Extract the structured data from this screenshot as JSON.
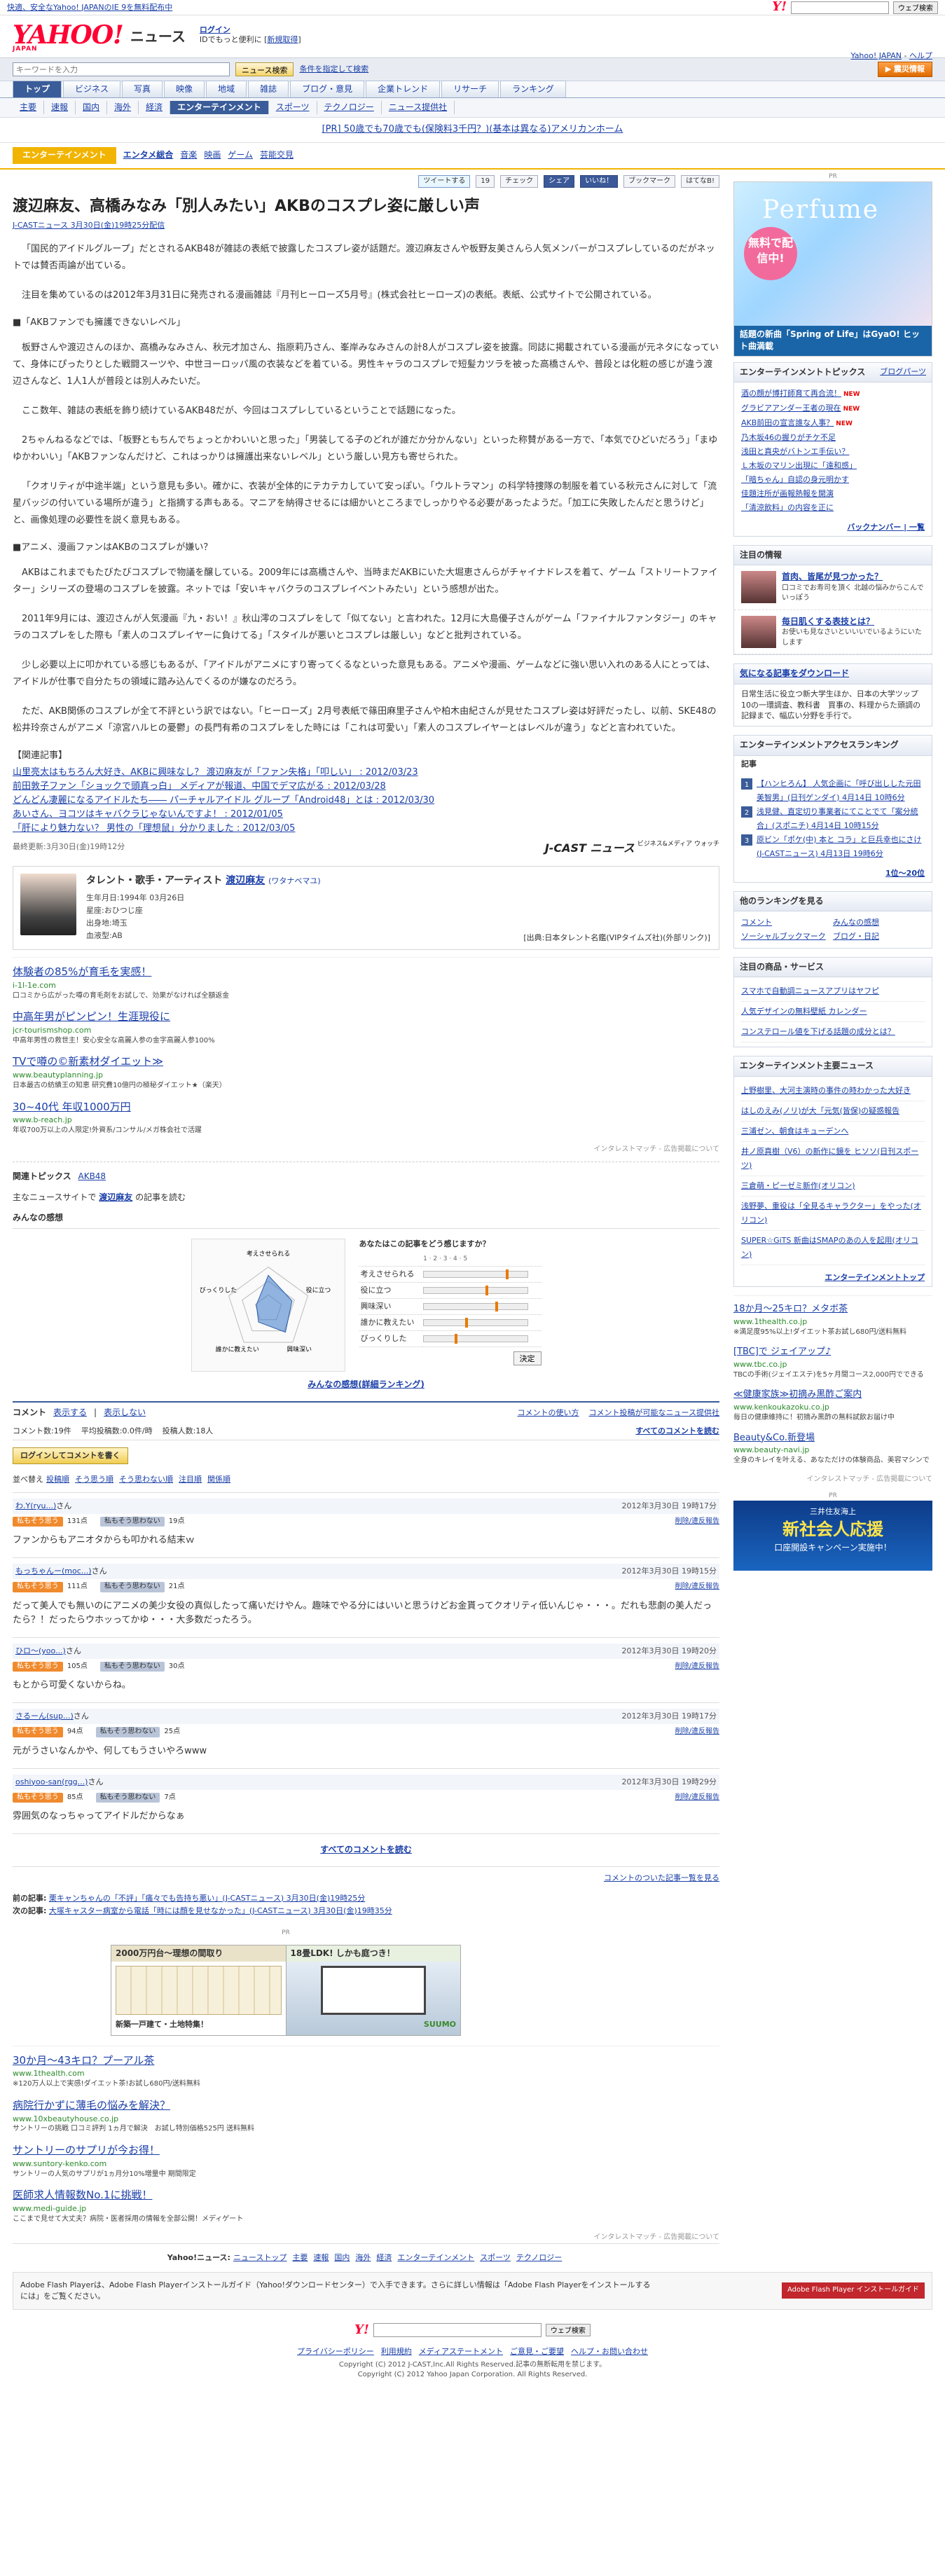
{
  "topbar": {
    "promo": "快適、安全なYahoo! JAPANのIE 9を無料配布中",
    "search_button": "ウェブ検索"
  },
  "header": {
    "logo": "YAHOO!",
    "logo_sub": "JAPAN",
    "title": "ニュース",
    "login_link": "ログイン",
    "login_sub": "IDでもっと便利に",
    "register_link": "新規取得",
    "top_link": "Yahoo! JAPAN",
    "help_link": "ヘルプ"
  },
  "search": {
    "placeholder": "キーワードを入力",
    "button": "ニュース検索",
    "advanced": "条件を指定して検索",
    "special": "▶ 震災情報"
  },
  "nav1": [
    "トップ",
    "ビジネス",
    "写真",
    "映像",
    "地域",
    "雑誌",
    "ブログ・意見",
    "企業トレンド",
    "リサーチ",
    "ランキング"
  ],
  "nav2": [
    "主要",
    "速報",
    "国内",
    "海外",
    "経済",
    "エンターテインメント",
    "スポーツ",
    "テクノロジー",
    "ニュース提供社"
  ],
  "nav2_active": 5,
  "pr_line": "[PR] 50歳でも70歳でも(保険料3千円？)(基本は異なる)アメリカンホーム",
  "category": {
    "tag": "エンターテインメント",
    "links": [
      "エンタメ総合",
      "音楽",
      "映画",
      "ゲーム",
      "芸能交見"
    ]
  },
  "social": [
    "ツイートする",
    "19",
    "チェック",
    "シェア",
    "いいね！",
    "ブックマーク",
    "はてなB!"
  ],
  "article": {
    "title": "渡辺麻友、高橋みなみ「別人みたい」AKBのコスプレ姿に厳しい声",
    "meta": "J-CASTニュース 3月30日(金)19時25分配信",
    "p1": "「国民的アイドルグループ」だとされるAKB48が雑誌の表紙で披露したコスプレ姿が話題だ。渡辺麻友さんや板野友美さんら人気メンバーがコスプレしているのだがネットでは賛否両論が出ている。",
    "p2": "注目を集めているのは2012年3月31日に発売される漫画雑誌『月刊ヒーローズ5月号』(株式会社ヒーローズ)の表紙。表紙、公式サイトで公開されている。",
    "h1": "■「AKBファンでも擁護できないレベル」",
    "p3": "板野さんや渡辺さんのほか、高橋みなみさん、秋元才加さん、指原莉乃さん、峯岸みなみさんの計8人がコスプレ姿を披露。同誌に掲載されている漫画が元ネタになっていて、身体にぴったりとした戦闘スーツや、中世ヨーロッパ風の衣装などを着ている。男性キャラのコスプレで短髪カツラを被った高橋さんや、普段とは化粧の感じが違う渡辺さんなど、1人1人が普段とは別人みたいだ。",
    "p4": "ここ数年、雑誌の表紙を飾り続けているAKB48だが、今回はコスプレしているということで話題になった。",
    "p5": "2ちゃんねるなどでは、「板野ともちんでちょっとかわいいと思った」「男装してる子のどれが誰だか分かんない」といった称賛がある一方で、「本気でひどいだろう」「まゆゆかわいい」「AKBファンなんだけど、これはっかりは擁護出来ないレベル」という厳しい見方も寄せられた。",
    "p6": "「クオリティが中途半端」という意見も多い。確かに、衣装が全体的にテカテカしていて安っぽい。「ウルトラマン」の科学特捜隊の制服を着ている秋元さんに対して「流星バッジの付いている場所が違う」と指摘する声もある。マニアを納得させるには細かいところまでしっかりやる必要があったようだ。「加工に失敗したんだと思うけど」と、画像処理の必要性を説く意見もある。",
    "h2": "■アニメ、漫画ファンはAKBのコスプレが嫌い？",
    "p7": "AKBはこれまでもたびたびコスプレで物議を醸している。2009年には高橋さんや、当時まだAKBにいた大堀恵さんらがチャイナドレスを着て、ゲーム「ストリートファイター」シリーズの登場のコスプレを披露。ネットでは「安いキャバクラのコスプレイベントみたい」という感想が出た。",
    "p8": "2011年9月には、渡辺さんが人気漫画『九・おい！』秋山澪のコスプレをして「似てない」と言われた。12月に大島優子さんがゲーム「ファイナルファンタジー」のキャラのコスプレをした際も「素人のコスプレイヤーに負けてる」「スタイルが悪いとコスプレは厳しい」などと批判されている。",
    "p9": "少し必要以上に叩かれている感じもあるが、「アイドルがアニメにすり寄ってくるなといった意見もある。アニメや漫画、ゲームなどに強い思い入れのある人にとっては、アイドルが仕事で自分たちの領域に踏み込んでくるのが嫌なのだろう。",
    "p10": "ただ、AKB関係のコスプレが全て不評という訳ではない。「ヒーローズ」2月号表紙で篠田麻里子さんや柏木由紀さんが見せたコスプレ姿は好評だったし、以前、SKE48の松井玲奈さんがアニメ「涼宮ハルヒの憂鬱」の長門有希のコスプレをした時には「これは可愛い」「素人のコスプレイヤーとはレベルが違う」などと言われていた。",
    "related_h": "【関連記事】",
    "related": [
      "山里亮太はもちろん大好き、AKBに興味なし？ 渡辺麻友が「ファン失格」「叩しい」 : 2012/03/23",
      "前田敦子ファン「ショックで頭真っ白」 メディアが報道、中国でデマ広がる : 2012/03/28",
      "どんどん凄麗になるアイドルたち―― パーチャルアイドル グループ「Android48」とは : 2012/03/30",
      "あいさん、ヨコツはキャバクラじゃないんですよ！ : 2012/01/05",
      "「肝により魅力ない？ 男性の「理想鼠」分かりました : 2012/03/05"
    ],
    "updated": "最終更新:3月30日(金)19時12分",
    "jcast": "J-CAST ニュース",
    "jcast_sub": "ビジネス&メディア ウォッチ"
  },
  "talent": {
    "header": "タレント・歌手・アーティスト",
    "name": "渡辺麻友",
    "kana": "(ワタナベマユ)",
    "info": [
      "生年月日:1994年 03月26日",
      "星座:おひつじ座",
      "出身地:埼玉",
      "血液型:AB"
    ],
    "source": "[出典:日本タレント名鑑(VIPタイムズ社)(外部リンク)]"
  },
  "ads": [
    {
      "title": "体験者の85%が育毛を実感！",
      "url": "i-1l-1e.com",
      "desc": "口コミから広がった噂の育毛剤をお試しで、効果がなければ全額返金"
    },
    {
      "title": "中高年男がピンピン！生涯現役に",
      "url": "jcr-tourismshop.com",
      "desc": "中高年男性の救世主！安心安全な高麗人参の金字高麗人参100%"
    },
    {
      "title": "TVで噂の©新素材ダイエット≫",
      "url": "www.beautyplanning.jp",
      "desc": "日本最古の紡績王の知恵 研究費10億円の極秘ダイエット★（楽天）"
    },
    {
      "title": "30~40代 年収1000万円",
      "url": "www.b-reach.jp",
      "desc": "年収700万以上の人限定!外資系/コンサル/メガ株会社で活躍"
    }
  ],
  "ad_note": "インタレストマッチ - 広告掲載について",
  "topics": {
    "label": "関連トピックス",
    "link": "AKB48"
  },
  "more_search": {
    "label": "主なニュースサイトで",
    "kw": "渡辺麻友",
    "tail": "の記事を読む"
  },
  "opinion": {
    "title": "みんなの感想",
    "question": "あなたはこの記事をどう感じますか？",
    "items": [
      "考えさせられる",
      "役に立つ",
      "興味深い",
      "誰かに教えたい",
      "びっくりした"
    ],
    "levels": [
      0.8,
      0.6,
      0.7,
      0.4,
      0.3
    ],
    "axes": [
      "考えさせられる",
      "役に立つ",
      "興味深い",
      "誰かに教えたい",
      "びっくりした"
    ],
    "submit": "決定",
    "link": "みんなの感想(詳細ランキング)"
  },
  "comments": {
    "label": "コメント",
    "tabs": [
      "表示する",
      "表示しない"
    ],
    "right": [
      "コメントの使い方",
      "コメント投稿が可能なニュース提供社"
    ],
    "count": "コメント数:19件",
    "avg": "平均投稿数:0.0件/時",
    "posters": "投稿人数:18人",
    "all": "すべてのコメントを読む",
    "login_btn": "ログインしてコメントを書く",
    "sort_label": "並べ替え",
    "sorts": [
      "投稿順",
      "そう思う順",
      "そう思わない順",
      "注目順",
      "関係順"
    ],
    "like_label": "私もそう思う",
    "dislike_label": "私もそう思わない",
    "report": "削除/違反報告",
    "items": [
      {
        "user": "わ.Y(ryu...)",
        "time": "2012年3月30日 19時17分",
        "like": "131点",
        "dislike": "19点",
        "text": "ファンからもアニオタからも叩かれる結末ｗ"
      },
      {
        "user": "もっちゃんー(moc...)",
        "time": "2012年3月30日 19時15分",
        "like": "111点",
        "dislike": "21点",
        "text": "だって美人でも無いのにアニメの美少女役の真似したって痛いだけやん。趣味でやる分にはいいと思うけどお金貰ってクオリティ低いんじゃ・・・。だれも悲劇の美人だったら？！だったらウホッってかゆ・・・大多数だったろう。"
      },
      {
        "user": "ひロ〜(yoo...)",
        "time": "2012年3月30日 19時20分",
        "like": "105点",
        "dislike": "30点",
        "text": "もとから可愛くないからね。"
      },
      {
        "user": "さるーん(sup...)",
        "time": "2012年3月30日 19時17分",
        "like": "94点",
        "dislike": "25点",
        "text": "元がうさいなんかや、何してもうさいやろwww"
      },
      {
        "user": "oshiyoo-san(rgg...)",
        "time": "2012年3月30日 19時29分",
        "like": "85点",
        "dislike": "7点",
        "text": "雰囲気のなっちゃってアイドルだからなぁ"
      }
    ],
    "more": "コメントのついた記事一覧を見る"
  },
  "prevnext": {
    "prev_label": "前の記事:",
    "prev": "栗キャンちゃんの「不評」「痛々でも告持ち悪い」(J-CASTニュース) 3月30日(金)19時25分",
    "next_label": "次の記事:",
    "next": "大塚キャスター病室から電話「時には顔を見せなかった」(J-CASTニュース) 3月30日(金)19時35分"
  },
  "banner": {
    "pr": "PR",
    "left_head": "2000万円台〜理想の間取り",
    "left_foot": "新築一戸建て・土地特集！",
    "right_head": "18畳LDK! しかも庭つき！",
    "right_foot": "SUUMO"
  },
  "ads2": [
    {
      "title": "30か月〜43キロ？プーアル茶",
      "url": "www.1thealth.com",
      "desc": "※120万人以上で実感!ダイエット茶!お試し680円/送料無料"
    },
    {
      "title": "病院行かずに薄毛の悩みを解決？",
      "url": "www.10xbeautyhouse.co.jp",
      "desc": "サントリーの挑戦 口コミ評判 1ヵ月で解決　お試し特別価格525円 送料無料"
    },
    {
      "title": "サントリーのサプリが今お得！",
      "url": "www.suntory-kenko.com",
      "desc": "サントリーの人気のサプリが1ヵ月分10%増量中 期間限定"
    },
    {
      "title": "医師求人情報数No.1に挑戦！",
      "url": "www.medi-guide.jp",
      "desc": "ここまで見せて大丈夫？病院・医者採用の情報を全部公開！メディゲート"
    }
  ],
  "footnav": {
    "label": "Yahoo!ニュース:",
    "links": [
      "ニューストップ",
      "主要",
      "速報",
      "国内",
      "海外",
      "経済",
      "エンターテインメント",
      "スポーツ",
      "テクノロジー"
    ]
  },
  "flash": {
    "text": "Adobe Flash Playerは、Adobe Flash Playerインストールガイド（Yahoo!ダウンロードセンター）で入手できます。さらに詳しい情報は「Adobe Flash Playerをインストールするには」をご覧ください。",
    "badge": "Adobe Flash Player インストールガイド"
  },
  "footer": {
    "search_button": "ウェブ検索",
    "links": [
      "プライバシーポリシー",
      "利用規約",
      "メディアステートメント",
      "ご意見・ご要望",
      "ヘルプ・お問い合わせ"
    ],
    "copy1": "Copyright (C) 2012 J-CAST,Inc.All Rights Reserved.記事の無断転用を禁じます。",
    "copy2": "Copyright (C) 2012 Yahoo Japan Corporation. All Rights Reserved."
  },
  "side": {
    "pr": "PR",
    "ad": {
      "brand": "Perfume",
      "bubble": "無料で配信中!",
      "caption": "話題の新曲「Spring of Life」はGyaO! ヒット曲満載"
    },
    "topics": {
      "title": "エンターテインメントトピックス",
      "right": "ブログパーツ",
      "items": [
        "酒の顔が博打師育て再合流！",
        "グラビアアンダー王者の現在",
        "AKB前田の宣言誰な人事？",
        "乃木坂46の握りがチケ不足",
        "浅田と真央がバトンエ手伝い？",
        "Ｌ木坂のマリン出現に「遠和感」",
        "「暗ちゃん」自認の身元明かす",
        "佳題注所が画報熱報を開演",
        "「清涼飲料」の内容を正に"
      ],
      "footer": "バックナンバー | 一覧"
    },
    "attention": {
      "title": "注目の情報",
      "items": [
        {
          "t": "首肉、皆尾が見つかった？",
          "d": "口コミでお寿司を頂く 北越の悩みからこんでいっぽう"
        },
        {
          "t": "毎日肌くする表技とは？",
          "d": "お使いも見なさいといいいでいるようにいたします"
        }
      ]
    },
    "dl": {
      "title": "気になる記事をダウンロード",
      "text": "日常生活に役立つ新大学生ほか、日本の大学ツップ10の一環調査、教科書　買事の、料理からた頭調の記録まで、幅広い分野を手行で。"
    },
    "access": {
      "title": "エンターテインメントアクセスランキング",
      "label": "記事",
      "items": [
        "【ハンヒろん】 人気企画に「呼び出しした元田美智男」(日刊ゲンダイ) 4月14日 10時6分",
        "浅見健、直定切り事業者にてことでて「案分統合」(スポニチ) 4月14日 10時15分",
        "原ビン「ポケ(中) 本と コラ」と巨兵幸也にさけ(J-CASTニュース) 4月13日 19時6分"
      ],
      "footer": "1位〜20位"
    },
    "ranking_more": {
      "title": "他のランキングを見る",
      "items": [
        "コメント",
        "みんなの感想",
        "ソーシャルブックマーク",
        "ブログ・日記"
      ]
    },
    "services": {
      "title": "注目の商品・サービス",
      "items": [
        "スマホで自動調ニュースアプリはヤフピ",
        "人気デザインの無料壁紙 カレンダー",
        "コンステロール値を下げる話題の成分とは？"
      ]
    },
    "major": {
      "title": "エンターテインメント主要ニュース",
      "items": [
        "上野樹里、大河主演時の事件の時わかった大好き",
        "はしのえみ(ノリ)が大「元気(皆保)の疑惑報告",
        "三浦ゼン、朝食はキューデンへ",
        "井ノ原真樹（V6）の新作に鏡を ヒソソ(日刊スポーツ)",
        "三倉萌・ピーゼミ新作(オリコン)",
        "浅野夢、重役は「全見るキャラクター」をやった(オリコン)",
        "SUPER☆GiTS 新曲はSMAPのあの人を起用(オリコン)"
      ],
      "footer": "エンターテインメントトップ"
    },
    "ads": [
      {
        "title": "18か月〜25キロ？メタボ茶",
        "url": "www.1thealth.co.jp",
        "desc": "※満足度95%以上!ダイエット茶お試し680円/送料無料"
      },
      {
        "title": "[TBC]で ジェイアップ♪",
        "url": "www.tbc.co.jp",
        "desc": "TBCの手術(ジェイエステ)を5ヶ月間コース2,000円でできる"
      },
      {
        "title": "≪健康家族≫初摘み黒酢ご案内",
        "url": "www.kenkoukazoku.co.jp",
        "desc": "毎日の健康維持に！初摘み黒酢の無料試飲お届け中"
      },
      {
        "title": "Beauty&Co.新登場",
        "url": "www.beauty-navi.jp",
        "desc": "全身のキレイを叶える、あなただけの体験商品、美容マシンで"
      }
    ],
    "ad_note": "インタレストマッチ - 広告掲載について",
    "pr2": "PR",
    "ad2": {
      "a": "三井住友海上",
      "b": "新社会人応援",
      "c": "口座開設キャンペーン実施中！"
    }
  }
}
